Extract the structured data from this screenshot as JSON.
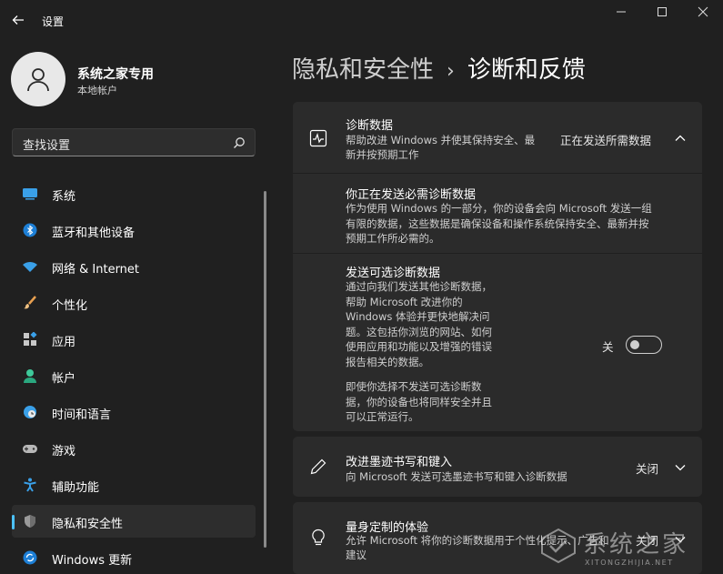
{
  "window": {
    "title": "设置",
    "controls": [
      "minimize",
      "maximize",
      "close"
    ]
  },
  "profile": {
    "name": "系统之家专用",
    "account_type": "本地帐户"
  },
  "search": {
    "placeholder": "查找设置"
  },
  "sidebar": {
    "items": [
      {
        "label": "系统",
        "icon": "monitor-icon"
      },
      {
        "label": "蓝牙和其他设备",
        "icon": "bluetooth-icon"
      },
      {
        "label": "网络 & Internet",
        "icon": "wifi-icon"
      },
      {
        "label": "个性化",
        "icon": "brush-icon"
      },
      {
        "label": "应用",
        "icon": "apps-icon"
      },
      {
        "label": "帐户",
        "icon": "person-icon"
      },
      {
        "label": "时间和语言",
        "icon": "globe-clock-icon"
      },
      {
        "label": "游戏",
        "icon": "gamepad-icon"
      },
      {
        "label": "辅助功能",
        "icon": "accessibility-icon"
      },
      {
        "label": "隐私和安全性",
        "icon": "shield-icon",
        "selected": true
      },
      {
        "label": "Windows 更新",
        "icon": "update-icon"
      }
    ]
  },
  "breadcrumb": {
    "parent": "隐私和安全性",
    "separator": "›",
    "current": "诊断和反馈"
  },
  "diagnostic": {
    "title": "诊断数据",
    "desc_line1": "帮助改进 Windows 并使其保持安全、最",
    "desc_line2": "新并按预期工作",
    "status": "正在发送所需数据",
    "required": {
      "title": "你正在发送必需诊断数据",
      "lines": [
        "作为使用 Windows 的一部分，你的设备会向 Microsoft 发送一组",
        "有限的数据，这些数据是确保设备和操作系统保持安全、最新并按",
        "预期工作所必需的。"
      ]
    },
    "optional": {
      "title": "发送可选诊断数据",
      "lines": [
        "通过向我们发送其他诊断数据，",
        "帮助 Microsoft 改进你的",
        "Windows 体验并更快地解决问",
        "题。这包括你浏览的网站、如何",
        "使用应用和功能以及增强的错误",
        "报告相关的数据。"
      ],
      "note_lines": [
        "即使你选择不发送可选诊断数",
        "据，你的设备也将同样安全并且",
        "可以正常运行。"
      ],
      "toggle_label": "关",
      "toggle_on": false
    }
  },
  "inking": {
    "title": "改进墨迹书写和键入",
    "desc": "向 Microsoft 发送可选墨迹书写和键入诊断数据",
    "status": "关闭"
  },
  "tailored": {
    "title": "量身定制的体验",
    "desc_line1": "允许 Microsoft 将你的诊断数据用于个性化提示、广告和",
    "desc_line2": "建议",
    "status": "关闭"
  },
  "watermark": {
    "text": "系统之家",
    "sub": "XITONGZHIJIA.NET"
  },
  "colors": {
    "background": "#202020",
    "card": "#2b2b2b",
    "accent": "#4cc2ff"
  }
}
